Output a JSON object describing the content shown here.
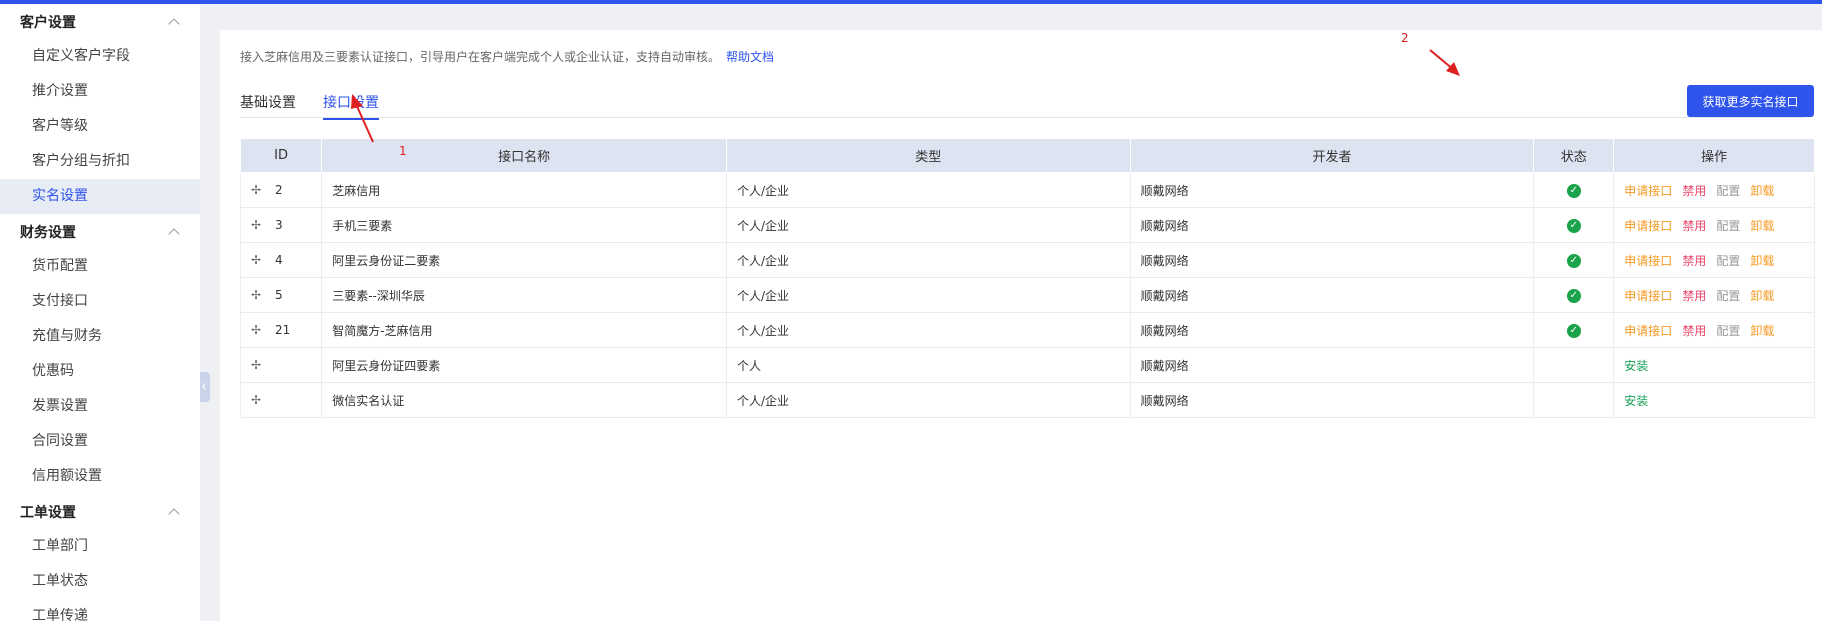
{
  "sidebar": {
    "groups": [
      {
        "title": "客户设置",
        "items": [
          {
            "label": "自定义客户字段",
            "active": false
          },
          {
            "label": "推介设置",
            "active": false
          },
          {
            "label": "客户等级",
            "active": false
          },
          {
            "label": "客户分组与折扣",
            "active": false
          },
          {
            "label": "实名设置",
            "active": true
          }
        ]
      },
      {
        "title": "财务设置",
        "items": [
          {
            "label": "货币配置",
            "active": false
          },
          {
            "label": "支付接口",
            "active": false
          },
          {
            "label": "充值与财务",
            "active": false
          },
          {
            "label": "优惠码",
            "active": false
          },
          {
            "label": "发票设置",
            "active": false
          },
          {
            "label": "合同设置",
            "active": false
          },
          {
            "label": "信用额设置",
            "active": false
          }
        ]
      },
      {
        "title": "工单设置",
        "items": [
          {
            "label": "工单部门",
            "active": false
          },
          {
            "label": "工单状态",
            "active": false
          },
          {
            "label": "工单传递",
            "active": false
          }
        ]
      }
    ]
  },
  "main": {
    "description": "接入芝麻信用及三要素认证接口，引导用户在客户端完成个人或企业认证，支持自动审核。",
    "help_link": "帮助文档",
    "tabs": [
      {
        "label": "基础设置",
        "active": false
      },
      {
        "label": "接口设置",
        "active": true
      }
    ],
    "more_button": "获取更多实名接口",
    "table": {
      "headers": [
        "ID",
        "接口名称",
        "类型",
        "开发者",
        "状态",
        "操作"
      ],
      "rows": [
        {
          "id": "2",
          "name": "芝麻信用",
          "type": "个人/企业",
          "developer": "顺戴网络",
          "enabled": true
        },
        {
          "id": "3",
          "name": "手机三要素",
          "type": "个人/企业",
          "developer": "顺戴网络",
          "enabled": true
        },
        {
          "id": "4",
          "name": "阿里云身份证二要素",
          "type": "个人/企业",
          "developer": "顺戴网络",
          "enabled": true
        },
        {
          "id": "5",
          "name": "三要素--深圳华辰",
          "type": "个人/企业",
          "developer": "顺戴网络",
          "enabled": true
        },
        {
          "id": "21",
          "name": "智简魔方-芝麻信用",
          "type": "个人/企业",
          "developer": "顺戴网络",
          "enabled": true
        },
        {
          "id": "",
          "name": "阿里云身份证四要素",
          "type": "个人",
          "developer": "顺戴网络",
          "enabled": false
        },
        {
          "id": "",
          "name": "微信实名认证",
          "type": "个人/企业",
          "developer": "顺戴网络",
          "enabled": false
        }
      ],
      "actions_installed": [
        "申请接口",
        "禁用",
        "配置",
        "卸载"
      ],
      "action_install": "安装"
    }
  },
  "annotations": [
    "1",
    "2"
  ],
  "colors": {
    "accent": "#2f54eb",
    "success": "#1aa34a",
    "warning": "#f59a23",
    "danger": "#e8466b",
    "annotation": "#e02020"
  }
}
